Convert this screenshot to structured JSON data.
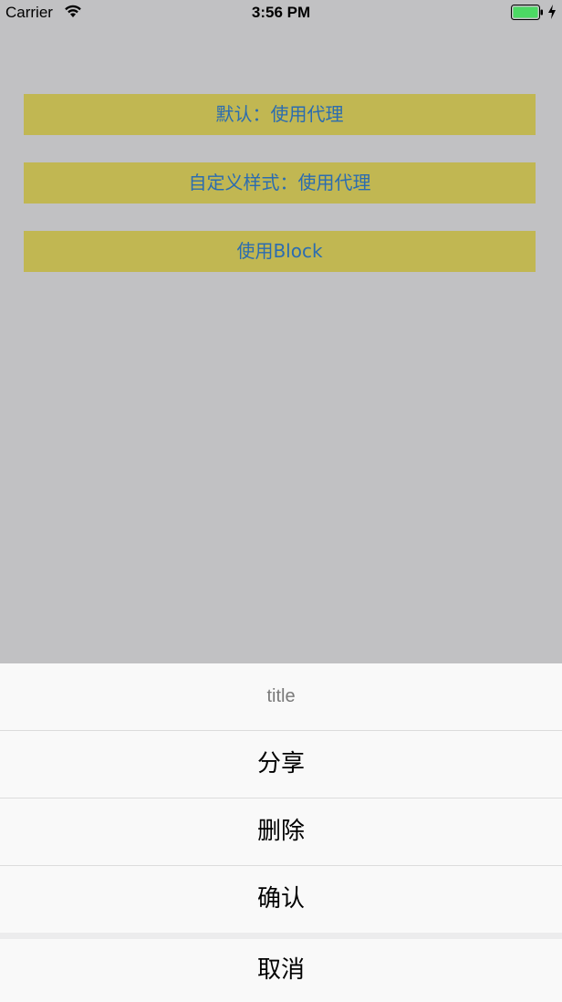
{
  "status_bar": {
    "carrier": "Carrier",
    "time": "3:56 PM",
    "battery_color": "#4cd964"
  },
  "buttons": [
    {
      "label": "默认：使用代理"
    },
    {
      "label": "自定义样式：使用代理"
    },
    {
      "label": "使用Block"
    }
  ],
  "action_sheet": {
    "title": "title",
    "items": [
      {
        "label": "分享"
      },
      {
        "label": "删除"
      },
      {
        "label": "确认"
      }
    ],
    "cancel": "取消"
  }
}
